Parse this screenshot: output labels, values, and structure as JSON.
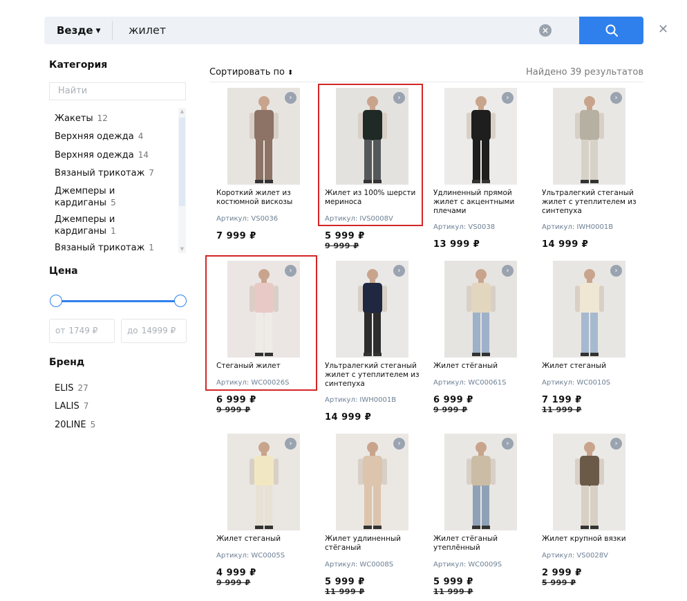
{
  "search": {
    "scope": "Везде",
    "query": "жилет"
  },
  "sidebar": {
    "category_title": "Категория",
    "filter_placeholder": "Найти",
    "categories": [
      {
        "label": "Жакеты",
        "count": "12"
      },
      {
        "label": "Верхняя одежда",
        "count": "4"
      },
      {
        "label": "Верхняя одежда",
        "count": "14"
      },
      {
        "label": "Вязаный трикотаж",
        "count": "7"
      },
      {
        "label": "Джемперы и",
        "label2": "кардиганы",
        "count": "5"
      },
      {
        "label": "Джемперы и",
        "label2": "кардиганы",
        "count": "1"
      },
      {
        "label": "Вязаный трикотаж",
        "count": "1"
      }
    ],
    "price_title": "Цена",
    "price_from_label": "от",
    "price_from": "1749 ₽",
    "price_to_label": "до",
    "price_to": "14999 ₽",
    "brand_title": "Бренд",
    "brands": [
      {
        "label": "ELIS",
        "count": "27"
      },
      {
        "label": "LALIS",
        "count": "7"
      },
      {
        "label": "20LINE",
        "count": "5"
      }
    ]
  },
  "results": {
    "sort_label": "Сортировать по",
    "found": "Найдено 39 результатов",
    "sku_prefix": "Артикул:",
    "products": [
      {
        "name": "Короткий жилет из костюмной вискозы",
        "sku": "VS0036",
        "price": "7 999 ₽",
        "old": ""
      },
      {
        "name": "Жилет из 100% шерсти мериноса",
        "sku": "IVS0008V",
        "price": "5 999 ₽",
        "old": "9 999 ₽"
      },
      {
        "name": "Удлиненный прямой жилет с акцентными плечами",
        "sku": "VS0038",
        "price": "13 999 ₽",
        "old": ""
      },
      {
        "name": "Ультралегкий стеганый жилет с утеплителем из синтепуха",
        "sku": "IWH0001B",
        "price": "14 999 ₽",
        "old": ""
      },
      {
        "name": "Стеганый жилет",
        "sku": "WC00026S",
        "price": "6 999 ₽",
        "old": "9 999 ₽"
      },
      {
        "name": "Ультралегкий стеганый жилет с утеплителем из синтепуха",
        "sku": "IWH0001B",
        "price": "14 999 ₽",
        "old": ""
      },
      {
        "name": "Жилет стёганый",
        "sku": "WC00061S",
        "price": "6 999 ₽",
        "old": "9 999 ₽"
      },
      {
        "name": "Жилет стеганый",
        "sku": "WC0010S",
        "price": "7 199 ₽",
        "old": "11 999 ₽"
      },
      {
        "name": "Жилет стеганый",
        "sku": "WC0005S",
        "price": "4 999 ₽",
        "old": "9 999 ₽"
      },
      {
        "name": "Жилет удлиненный стёганый",
        "sku": "WC0008S",
        "price": "5 999 ₽",
        "old": "11 999 ₽"
      },
      {
        "name": "Жилет стёганый утеплённый",
        "sku": "WC0009S",
        "price": "5 999 ₽",
        "old": "11 999 ₽"
      },
      {
        "name": "Жилет крупной вязки",
        "sku": "VS0028V",
        "price": "2 999 ₽",
        "old": "5 999 ₽"
      }
    ]
  },
  "colors": {
    "accent": "#2f80ed",
    "highlight": "#d42525"
  }
}
